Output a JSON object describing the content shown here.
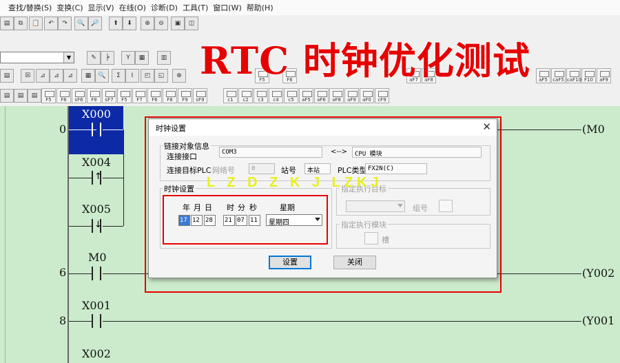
{
  "menu": [
    "查找/替换(S)",
    "变换(C)",
    "显示(V)",
    "在线(O)",
    "诊断(D)",
    "工具(T)",
    "窗口(W)",
    "帮助(H)"
  ],
  "toolbar": {
    "row3_fkeys": [
      "F5",
      "F6",
      "aF7",
      "aF8",
      "aF9"
    ],
    "row3_right_fkeys": [
      "aF5",
      "caF5",
      "caF10",
      "F10",
      "aF9"
    ],
    "row4_fkeys": [
      "F5",
      "F6",
      "sF6",
      "F8",
      "sF7",
      "F5",
      "F7",
      "F6",
      "F8",
      "F9",
      "sF9",
      "c1",
      "c2",
      "c3",
      "c4",
      "c5",
      "aF5",
      "aF6",
      "aF8",
      "aF9",
      "aF0",
      "cF9"
    ]
  },
  "overlay_title": "RTC 时钟优化测试",
  "watermark": "L Z D Z K J  LZKJ",
  "ladder": {
    "steps": [
      "0",
      "6",
      "8"
    ],
    "contacts": [
      "X000",
      "X004",
      "X005",
      "M0",
      "X001",
      "X002"
    ],
    "coils": [
      "M0",
      "Y002",
      "Y001"
    ]
  },
  "dialog": {
    "title": "时钟设置",
    "conn_group": "链接对象信息",
    "conn_port_label": "连接接口",
    "conn_port_value": "COM3",
    "arrow": "<-->",
    "cpu_value": "CPU 模块",
    "target_plc_label": "连接目标PLC",
    "network_label": "网络号",
    "network_value": "0",
    "station_label": "站号",
    "station_value": "本站",
    "plc_type_label": "PLC类型",
    "plc_type_value": "FX2N(C)",
    "clock_group": "时钟设置",
    "year_label": "年",
    "month_label": "月",
    "day_label": "日",
    "hour_label": "时",
    "minute_label": "分",
    "second_label": "秒",
    "weekday_label": "星期",
    "year": "17",
    "month": "12",
    "day": "28",
    "hour": "21",
    "minute": "07",
    "second": "11",
    "weekday": "星期四",
    "exec_target_group": "指定执行目标",
    "unit_label": "组号",
    "exec_module_group": "指定执行模块",
    "slot_label": "槽",
    "set_button": "设置",
    "close_button": "关闭"
  },
  "colors": {
    "ladder_bg": "#ccebcc",
    "cursor": "#0c2aa6",
    "highlight_red": "#e60000",
    "watermark_yellow": "#e8f000"
  }
}
